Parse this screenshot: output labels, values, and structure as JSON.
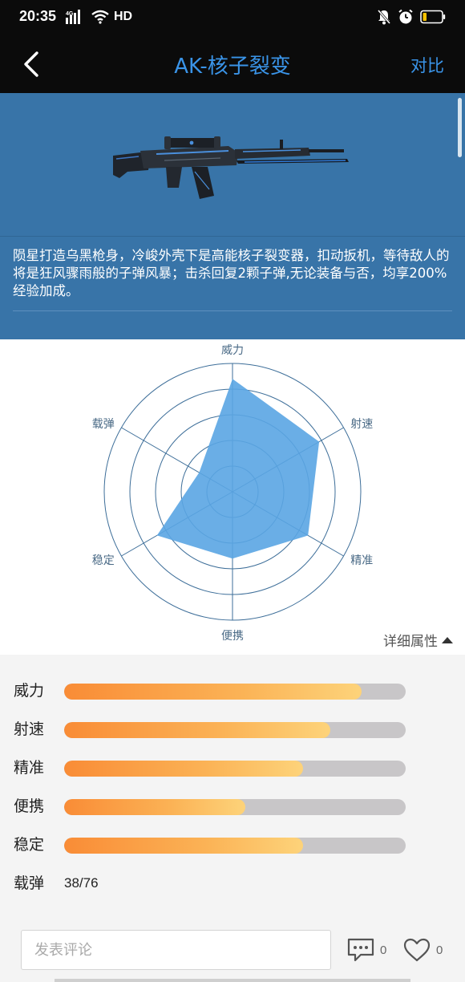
{
  "status": {
    "time": "20:35",
    "net_label": "4G",
    "hd_label": "HD"
  },
  "header": {
    "title": "AK-核子裂变",
    "compare_label": "对比"
  },
  "weapon": {
    "description": "陨星打造乌黑枪身，冷峻外壳下是高能核子裂变器，扣动扳机，等待敌人的将是狂风骤雨般的子弹风暴；击杀回复2颗子弹,无论装备与否，均享200%经验加成。"
  },
  "radar": {
    "axes": [
      "威力",
      "射速",
      "精准",
      "便携",
      "稳定",
      "载弹"
    ],
    "values": [
      0.88,
      0.78,
      0.68,
      0.52,
      0.68,
      0.3
    ],
    "fill_color": "#5aa5e3"
  },
  "details_toggle_label": "详细属性",
  "stats": [
    {
      "label": "威力",
      "value": 0.87
    },
    {
      "label": "射速",
      "value": 0.78
    },
    {
      "label": "精准",
      "value": 0.7
    },
    {
      "label": "便携",
      "value": 0.53
    },
    {
      "label": "稳定",
      "value": 0.7
    }
  ],
  "ammo": {
    "label": "载弹",
    "value": "38/76"
  },
  "comment": {
    "placeholder": "发表评论",
    "comment_count": "0",
    "like_count": "0"
  },
  "colors": {
    "accent": "#3a94e8",
    "banner": "#3874a8",
    "bar_start": "#f98c36",
    "bar_end": "#fdd37a",
    "bar_track": "#c8c6c8"
  }
}
